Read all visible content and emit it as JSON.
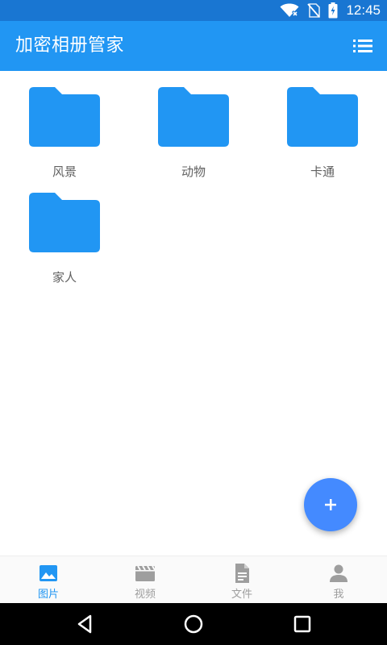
{
  "status_bar": {
    "time": "12:45",
    "icons": [
      "wifi-no-internet-icon",
      "no-sim-icon",
      "battery-charging-icon"
    ]
  },
  "app_bar": {
    "title": "加密相册管家",
    "menu_icon": "list-menu-icon"
  },
  "folders": [
    {
      "label": "风景",
      "icon": "folder-icon"
    },
    {
      "label": "动物",
      "icon": "folder-icon"
    },
    {
      "label": "卡通",
      "icon": "folder-icon"
    },
    {
      "label": "家人",
      "icon": "folder-icon"
    }
  ],
  "fab": {
    "icon": "plus-icon"
  },
  "bottom_nav": {
    "items": [
      {
        "label": "图片",
        "icon": "image-icon",
        "active": true
      },
      {
        "label": "视频",
        "icon": "video-clapper-icon",
        "active": false
      },
      {
        "label": "文件",
        "icon": "document-icon",
        "active": false
      },
      {
        "label": "我",
        "icon": "person-icon",
        "active": false
      }
    ]
  },
  "system_nav": {
    "icons": [
      "back-icon",
      "home-icon",
      "recents-icon"
    ]
  },
  "colors": {
    "status_bar": "#1976d2",
    "app_bar": "#2196f3",
    "folder": "#2196f3",
    "fab": "#448aff",
    "nav_active": "#2196f3",
    "nav_inactive": "#9e9e9e"
  }
}
